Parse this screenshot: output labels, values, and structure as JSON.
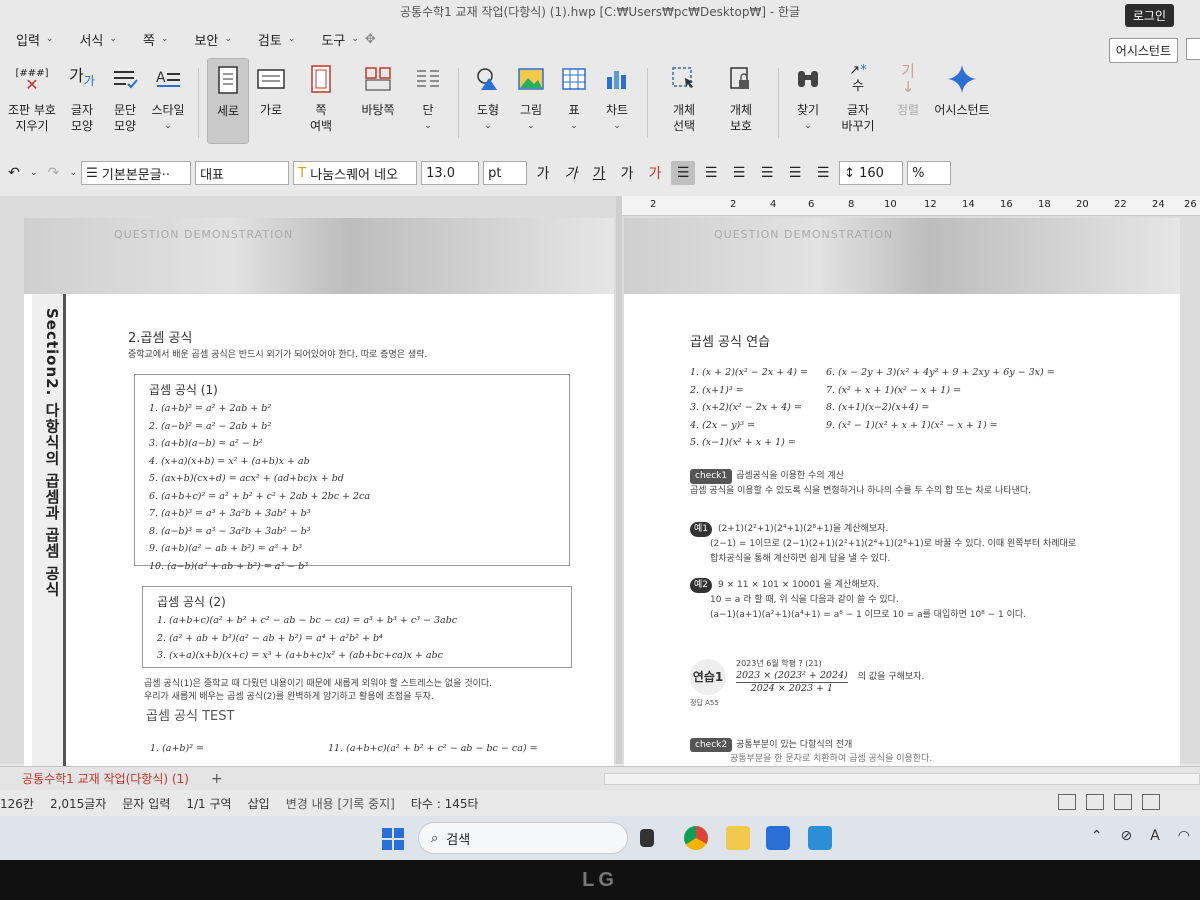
{
  "window": {
    "title": "공통수학1 교재 작업(다항식) (1).hwp [C:₩Users₩pc₩Desktop₩] - 한글",
    "login": "로그인"
  },
  "menu": [
    "입력",
    "서식",
    "쪽",
    "보안",
    "검토",
    "도구"
  ],
  "assistant_btn": "어시스턴트",
  "ribbon": {
    "reset": "[###]",
    "reset_label1": "조판 부호",
    "reset_label2": "지우기",
    "char_shape1": "글자",
    "char_shape2": "모양",
    "para_shape1": "문단",
    "para_shape2": "모양",
    "style": "스타일",
    "portrait": "세로",
    "landscape": "가로",
    "margin1": "쪽",
    "margin2": "여백",
    "background": "바탕쪽",
    "column": "단",
    "shape": "도형",
    "picture": "그림",
    "table": "표",
    "chart": "차트",
    "obj_select1": "개체",
    "obj_select2": "선택",
    "obj_protect1": "개체",
    "obj_protect2": "보호",
    "find": "찾기",
    "char_change1": "글자",
    "char_change2": "바꾸기",
    "proofread": "정렬",
    "ai_assistant": "어시스턴트"
  },
  "format": {
    "style_name": "기본본문글··",
    "style_sub": "대표",
    "font": "나눔스퀘어 네오",
    "size": "13.0",
    "unit": "pt",
    "line_spacing": "160",
    "percent": "%"
  },
  "ruler_ticks": [
    "2",
    "2",
    "4",
    "6",
    "8",
    "10",
    "12",
    "14",
    "16",
    "18",
    "20",
    "22",
    "24",
    "26"
  ],
  "left_page": {
    "header_dem": "QUESTION DEMONSTRATION",
    "vertical_title": "Section2. 다항식의 곱셈과 곱셈 공식",
    "section_title": "2.곱셈 공식",
    "intro": "중학교에서 배운 곱셈 공식은 반드시 외기가 되어있어야 한다. 따로 증명은 생략.",
    "box1_title": "곱셈 공식 (1)",
    "box1_items": [
      "1. (a+b)² = a² + 2ab + b²",
      "2. (a−b)² = a² − 2ab + b²",
      "3. (a+b)(a−b) = a² − b²",
      "4. (x+a)(x+b) = x² + (a+b)x + ab",
      "5. (ax+b)(cx+d) = acx² + (ad+bc)x + bd",
      "6. (a+b+c)² = a² + b² + c² + 2ab + 2bc + 2ca",
      "7. (a+b)³ = a³ + 3a²b + 3ab² + b³",
      "8. (a−b)³ = a³ − 3a²b + 3ab² − b³",
      "9. (a+b)(a² − ab + b²) = a³ + b³",
      "10. (a−b)(a² + ab + b²) = a³ − b³"
    ],
    "box2_title": "곱셈 공식 (2)",
    "box2_items": [
      "1. (a+b+c)(a² + b² + c² − ab − bc − ca) = a³ + b³ + c³ − 3abc",
      "2. (a² + ab + b²)(a² − ab + b²) = a⁴ + a²b² + b⁴",
      "3. (x+a)(x+b)(x+c) = x³ + (a+b+c)x² + (ab+bc+ca)x + abc"
    ],
    "note1": "곱셈 공식(1)은 중학교 때 다뤘던 내용이기 때문에 새롭게 외워야 할 스트레스는 없을 것이다.",
    "note2": "우리가 새롭게 배우는 곱셈 공식(2)를 완벽하게 암기하고 활용에 초점을 두자.",
    "test_title": "곱셈 공식 TEST",
    "test_item1": "1. (a+b)² =",
    "test_item11": "11. (a+b+c)(a² + b² + c² − ab − bc − ca) ="
  },
  "right_page": {
    "title": "곱셈 공식 연습",
    "practice_left": [
      "1. (x + 2)(x² − 2x + 4) =",
      "2. (x+1)³ =",
      "3. (x+2)(x² − 2x + 4) =",
      "4. (2x − y)³ =",
      "5. (x−1)(x² + x + 1) ="
    ],
    "practice_right": [
      "6. (x − 2y + 3)(x² + 4y² + 9 + 2xy + 6y − 3x) =",
      "7. (x² + x + 1)(x² − x + 1) =",
      "8. (x+1)(x−2)(x+4) =",
      "9. (x² − 1)(x² + x + 1)(x² − x + 1) ="
    ],
    "check1_badge": "check1",
    "check1_title": "곱셈공식을 이용한 수의 계산",
    "check1_desc": "곱셈 공식을 이용할 수 있도록 식을 변형하거나 하나의 수를 두 수의 합 또는 차로 나타낸다.",
    "ex1_badge": "예1",
    "ex1_q": "(2+1)(2²+1)(2⁴+1)(2⁸+1)을 계산해보자.",
    "ex1_a1": "(2−1) = 1이므로 (2−1)(2+1)(2²+1)(2⁴+1)(2⁸+1)로 바꿀 수 있다. 이때 왼쪽부터 차례대로",
    "ex1_a2": "합차공식을 통해 계산하면 쉽게 답을 낼 수 있다.",
    "ex2_badge": "예2",
    "ex2_q": "9 × 11 × 101 × 10001 을 계산해보자.",
    "ex2_a1": "10 = a 라 할 때, 위 식을 다음과 같이 쓸 수 있다.",
    "ex2_a2": "(a−1)(a+1)(a²+1)(a⁴+1) = a⁸ − 1 이므로 10 = a를 대입하면 10⁸ − 1 이다.",
    "practice_badge": "연습1",
    "practice_src": "2023년 6월 학평 ? (21)",
    "practice_q1": "2023 × (2023² + 2024)",
    "practice_q2": "2024 × 2023 + 1",
    "practice_q3": "의 값을 구해보자.",
    "practice_ans": "정답 A55",
    "check2_badge": "check2",
    "check2_title": "공통부분이 있는 다항식의 전개",
    "check2_desc": "공통부분을 한 문자로 치환하여 곱셈 공식을 이용한다."
  },
  "tabs": {
    "doc_tab": "공통수학1 교재 작업(다항식) (1)",
    "plus": "+"
  },
  "status": {
    "col": "126칸",
    "chars": "2,015글자",
    "mode": "문자 입력",
    "section": "1/1 구역",
    "insert": "삽입",
    "track": "변경 내용 [기록 중지]",
    "keystrokes": "타수 : 145타"
  },
  "taskbar": {
    "search": "검색",
    "tray_lang": "A"
  }
}
